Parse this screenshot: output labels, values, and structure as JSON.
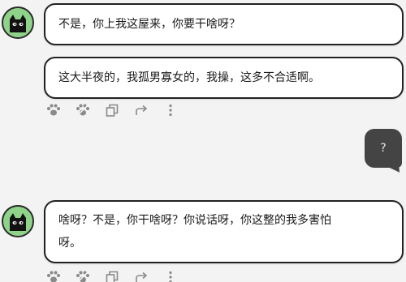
{
  "messages": [
    {
      "role": "assistant",
      "lines": [
        "不是，你上我这屋来，你要干啥呀？"
      ]
    },
    {
      "role": "assistant",
      "lines": [
        "这大半夜的，我孤男寡女的，我操，这多不合适啊。"
      ]
    },
    {
      "role": "user",
      "text": "?"
    },
    {
      "role": "assistant",
      "lines": [
        "啥呀？不是，你干啥呀？你说话呀，你这整的我多害怕",
        "呀。"
      ]
    }
  ],
  "actions": {
    "icons": [
      "paw-icon",
      "paw-alt-icon",
      "copy-icon",
      "share-icon",
      "more-icon"
    ]
  },
  "colors": {
    "background": "#f3f3f3",
    "bubble_border": "#222222",
    "user_bubble": "#444444",
    "avatar_green": "#8fd28a",
    "icon_gray": "#8a8a8a"
  }
}
